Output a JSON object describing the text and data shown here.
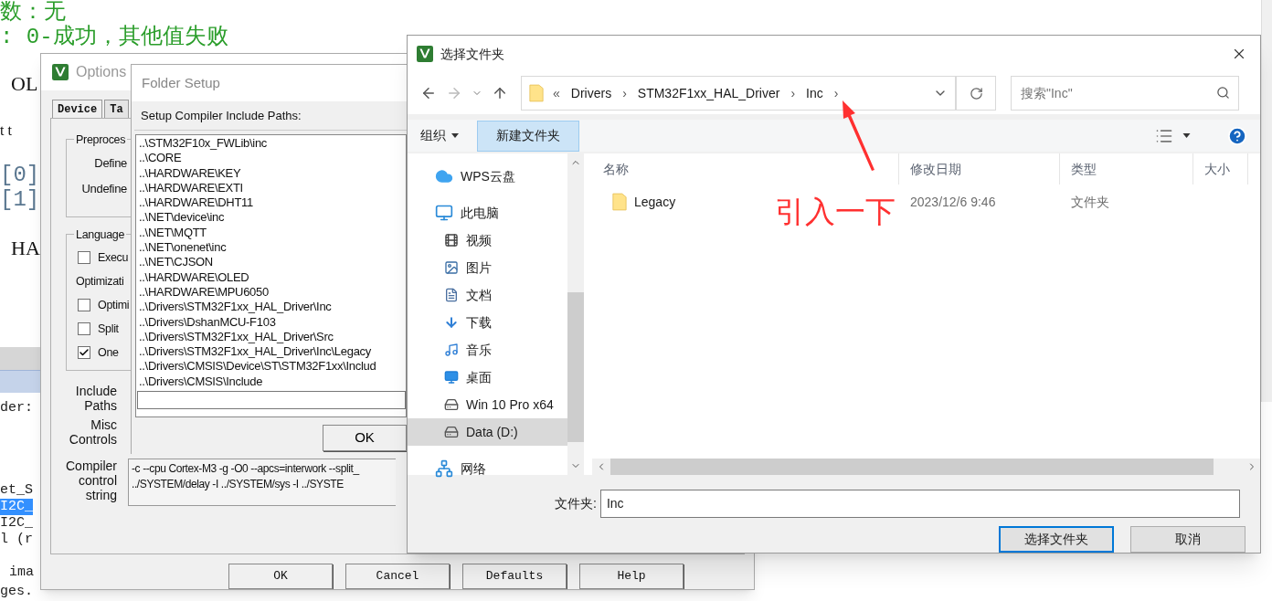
{
  "editor": {
    "upper_lines": [
      {
        "text": "数：无",
        "kind": "comment"
      },
      {
        "text": ": 0-成功，其他值失败",
        "kind": "comment"
      },
      {
        "text": "OL",
        "kind": "code"
      },
      {
        "text": "t t",
        "kind": "code"
      },
      {
        "text": "[0]",
        "kind": "index"
      },
      {
        "text": "[1]",
        "kind": "index"
      },
      {
        "text": "HA",
        "kind": "code"
      }
    ],
    "lower_lines": [
      {
        "text": "der:",
        "selected": false
      },
      {
        "text": "et_S",
        "selected": false
      },
      {
        "text": "I2C_",
        "selected": true
      },
      {
        "text": "I2C_",
        "selected": false
      },
      {
        "text": "l (r",
        "selected": false
      },
      {
        "text": "ima",
        "selected": false
      },
      {
        "text": "ges.",
        "selected": false
      }
    ]
  },
  "options_window": {
    "title": "Options",
    "tabs": [
      {
        "label": "Device",
        "selected": true
      },
      {
        "label": "Ta",
        "selected": false
      }
    ],
    "preprocessor": {
      "title": "Preproces",
      "fields": [
        "Define",
        "Undefine"
      ]
    },
    "language": {
      "title": "Language",
      "items": [
        {
          "kind": "checkbox",
          "label": "Execu",
          "checked": false
        },
        {
          "kind": "label",
          "label": "Optimizati"
        },
        {
          "kind": "checkbox",
          "label": "Optimi",
          "checked": false
        },
        {
          "kind": "checkbox",
          "label": "Split",
          "checked": false
        },
        {
          "kind": "checkbox",
          "label": "One",
          "checked": true
        }
      ]
    },
    "include_paths_label": "Include Paths",
    "misc_controls_label": "Misc Controls",
    "compiler_label": "Compiler control string",
    "compiler_string": [
      "-c --cpu Cortex-M3 -g -O0 --apcs=interwork --split_",
      "../SYSTEM/delay -I ../SYSTEM/sys -I ../SYSTE"
    ],
    "buttons": [
      "OK",
      "Cancel",
      "Defaults",
      "Help"
    ]
  },
  "folder_setup": {
    "title": "Folder Setup",
    "label": "Setup Compiler Include Paths:",
    "paths": [
      "..\\STM32F10x_FWLib\\inc",
      "..\\CORE",
      "..\\HARDWARE\\KEY",
      "..\\HARDWARE\\EXTI",
      "..\\HARDWARE\\DHT11",
      "..\\NET\\device\\inc",
      "..\\NET\\MQTT",
      "..\\NET\\onenet\\inc",
      "..\\NET\\CJSON",
      "..\\HARDWARE\\OLED",
      "..\\HARDWARE\\MPU6050",
      "..\\Drivers\\STM32F1xx_HAL_Driver\\Inc",
      "..\\Drivers\\DshanMCU-F103",
      "..\\Drivers\\STM32F1xx_HAL_Driver\\Src",
      "..\\Drivers\\STM32F1xx_HAL_Driver\\Inc\\Legacy",
      "..\\Drivers\\CMSIS\\Device\\ST\\STM32F1xx\\Includ",
      "..\\Drivers\\CMSIS\\Include"
    ],
    "ok": "OK"
  },
  "file_dialog": {
    "title": "选择文件夹",
    "address": {
      "prefix": "«",
      "segments": [
        "Drivers",
        "STM32F1xx_HAL_Driver",
        "Inc"
      ],
      "separator": "›"
    },
    "search": {
      "placeholder": "搜索\"Inc\""
    },
    "toolbar": {
      "organize": "组织",
      "new_folder": "新建文件夹"
    },
    "nav": [
      {
        "label": "WPS云盘",
        "kind": "cloud",
        "selected": false
      },
      {
        "label": "此电脑",
        "kind": "pc",
        "selected": false,
        "children": [
          {
            "label": "视频",
            "kind": "video",
            "selected": false
          },
          {
            "label": "图片",
            "kind": "picture",
            "selected": false
          },
          {
            "label": "文档",
            "kind": "document",
            "selected": false
          },
          {
            "label": "下载",
            "kind": "download",
            "selected": false
          },
          {
            "label": "音乐",
            "kind": "music",
            "selected": false
          },
          {
            "label": "桌面",
            "kind": "desktop",
            "selected": false
          },
          {
            "label": "Win 10 Pro x64",
            "kind": "system_drive",
            "selected": false
          },
          {
            "label": "Data (D:)",
            "kind": "drive",
            "selected": true
          }
        ]
      },
      {
        "label": "网络",
        "kind": "network",
        "selected": false
      }
    ],
    "columns": [
      "名称",
      "修改日期",
      "类型",
      "大小"
    ],
    "rows": [
      {
        "name": "Legacy",
        "modified": "2023/12/6 9:46",
        "type": "文件夹"
      }
    ],
    "folder_label": "文件夹:",
    "folder_value": "Inc",
    "buttons": [
      {
        "label": "选择文件夹",
        "selected": true
      },
      {
        "label": "取消",
        "selected": false
      }
    ]
  },
  "annotation": {
    "text": "引入一下"
  }
}
